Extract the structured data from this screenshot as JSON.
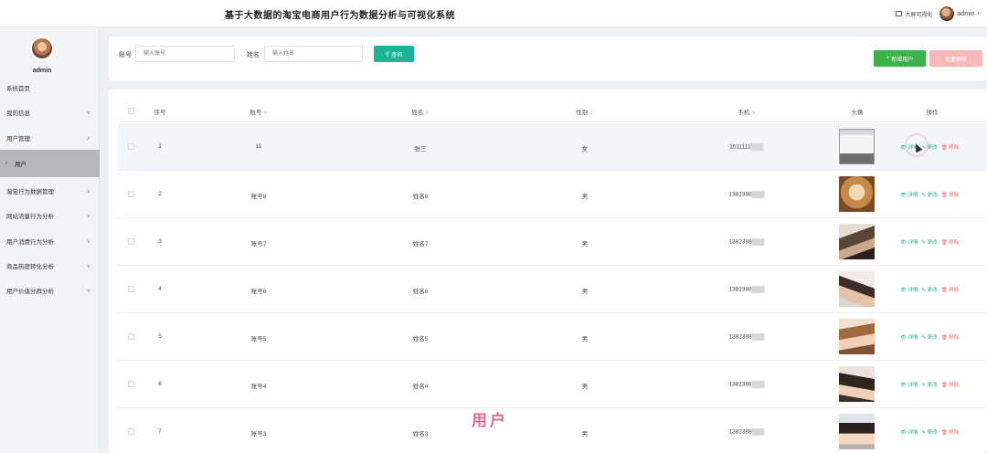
{
  "header": {
    "title": "基于大数据的淘宝电商用户行为数据分析与可视化系统",
    "bigscreen_label": "大屏可视化",
    "user_name": "admin"
  },
  "sidebar": {
    "admin_name": "admin",
    "items": [
      {
        "label": "系统首页",
        "chevron": ""
      },
      {
        "label": "我的信息",
        "chevron": "∨"
      },
      {
        "label": "用户管理",
        "chevron": "∧"
      },
      {
        "label": "用户",
        "chevron": "›"
      },
      {
        "label": "淘宝行为数据管理",
        "chevron": "∨"
      },
      {
        "label": "网站流量行为分析",
        "chevron": "∨"
      },
      {
        "label": "用户消费行为分析",
        "chevron": "∨"
      },
      {
        "label": "商品热度转化分析",
        "chevron": "∨"
      },
      {
        "label": "用户价值分群分析",
        "chevron": "∨"
      }
    ]
  },
  "search": {
    "account_label": "账号",
    "account_placeholder": "输入账号",
    "name_label": "姓名",
    "name_placeholder": "输入姓名",
    "query_label": "查询",
    "add_label": "新增用户",
    "batch_delete_label": "批量删除"
  },
  "table": {
    "headers": {
      "index": "序号",
      "account": "账号",
      "name": "姓名",
      "gender": "性别",
      "phone": "手机",
      "avatar": "头像",
      "ops": "操作"
    },
    "ops_labels": {
      "detail": "详情",
      "edit": "更改",
      "delete": "移除"
    },
    "rows": [
      {
        "index": "1",
        "account": "11",
        "name": "张三",
        "gender": "女",
        "phone": "1511111"
      },
      {
        "index": "2",
        "account": "账号8",
        "name": "姓名8",
        "gender": "男",
        "phone": "1382388"
      },
      {
        "index": "3",
        "account": "账号7",
        "name": "姓名7",
        "gender": "男",
        "phone": "1382388"
      },
      {
        "index": "4",
        "account": "账号6",
        "name": "姓名6",
        "gender": "男",
        "phone": "1382388"
      },
      {
        "index": "5",
        "account": "账号5",
        "name": "姓名5",
        "gender": "男",
        "phone": "1382388"
      },
      {
        "index": "6",
        "account": "账号4",
        "name": "姓名4",
        "gender": "男",
        "phone": "1382388"
      },
      {
        "index": "7",
        "account": "账号3",
        "name": "姓名3",
        "gender": "男",
        "phone": "1382388"
      }
    ]
  },
  "watermark": "用户",
  "colors": {
    "accent": "#1ab394",
    "add": "#3bb54a",
    "danger": "#f56c6c"
  }
}
